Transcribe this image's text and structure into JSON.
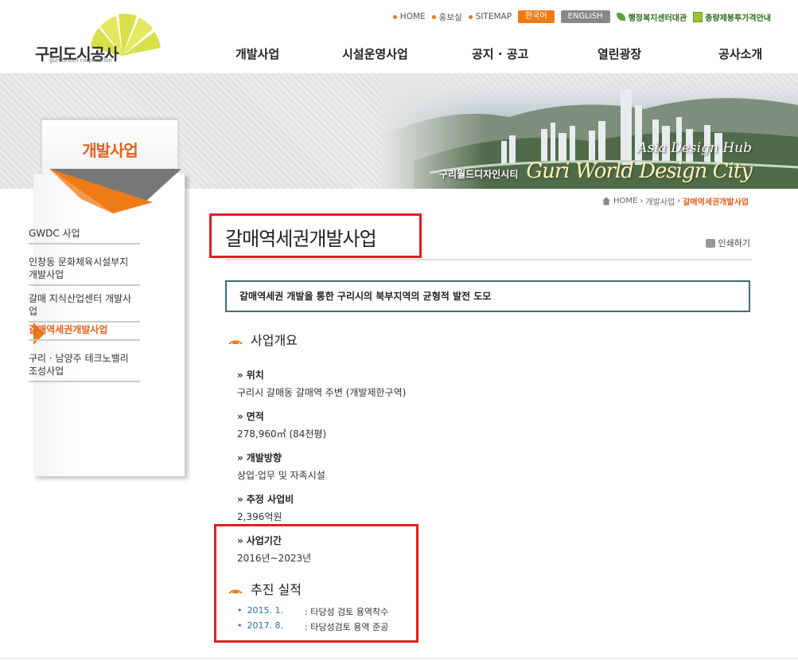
{
  "header": {
    "logo_text": "구리도시공사",
    "logo_sub": "guri urban corporation",
    "util": {
      "home": "HOME",
      "pr": "홍보실",
      "sitemap": "SITEMAP",
      "korean": "한국어",
      "english": "ENGLISH",
      "admin_center": "행정복지센터대관",
      "fee_info": "종량제봉투가격안내"
    },
    "gnb": [
      "개발사업",
      "시설운영사업",
      "공지 · 공고",
      "열린광장",
      "공사소개"
    ]
  },
  "banner": {
    "subtitle": "Asia Design Hub",
    "title": "Guri World Design City",
    "korean": "구리월드디자인시티"
  },
  "lnb": {
    "title": "개발사업",
    "items": [
      "GWDC 사업",
      "인창동 문화체육시설부지 개발사업",
      "갈매 지식산업센터 개발사업",
      "갈매역세권개발사업",
      "구리 · 남양주 테크노밸리 조성사업"
    ]
  },
  "breadcrumb": {
    "home": "HOME",
    "level1": "개발사업",
    "current": "갈매역세권개발사업"
  },
  "page": {
    "title": "갈매역세권개발사업",
    "print": "인쇄하기",
    "summary": "갈매역세권 개발을 통한 구리시의 북부지역의 균형적 발전 도모",
    "overview_heading": "사업개요",
    "fields": [
      {
        "label": "위치",
        "value": "구리시 갈매동 갈매역 주변 (개발제한구역)"
      },
      {
        "label": "면적",
        "value": "278,960㎡ (84천평)"
      },
      {
        "label": "개발방향",
        "value": "상업·업무 및 자족시설"
      },
      {
        "label": "추정 사업비",
        "value": "2,396억원"
      },
      {
        "label": "사업기간",
        "value": "2016년~2023년"
      }
    ],
    "results_heading": "추진 실적",
    "results": [
      {
        "date": "2015. 1.",
        "desc": ": 타당성 검토 용역착수"
      },
      {
        "date": "2017. 8.",
        "desc": ": 타당성검토 용역 준공"
      }
    ]
  },
  "colors": {
    "accent": "#ef7a18",
    "active_text": "#e8601d",
    "summary_border": "#3f6d73",
    "highlight_box": "#e02020",
    "link_blue": "#2a6fb0"
  }
}
